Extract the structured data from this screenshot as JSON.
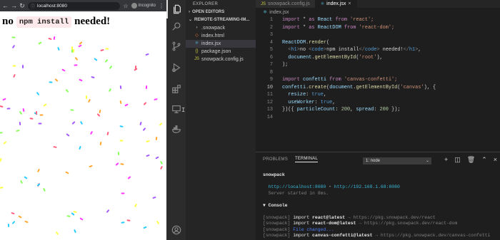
{
  "browser": {
    "url": "localhost:8080",
    "incognito_label": "Incognito",
    "heading_prefix": "no",
    "heading_code": "npm install",
    "heading_suffix": "needed!",
    "confetti_colors": [
      "#26ccff",
      "#a25afd",
      "#ff5e7e",
      "#88ff5a",
      "#fcff42",
      "#ffa62d",
      "#ff36ff"
    ]
  },
  "sidebar": {
    "title": "EXPLORER",
    "open_editors": "OPEN EDITORS",
    "project": "REMOTE-STREAMING-IM...",
    "files": [
      {
        "name": ".snowpack",
        "icon": "folder-icon",
        "icon_char": "›",
        "color": "#c5c5c5"
      },
      {
        "name": "index.html",
        "icon": "html-file-icon",
        "icon_char": "◇",
        "color": "#e37933"
      },
      {
        "name": "index.jsx",
        "icon": "jsx-file-icon",
        "icon_char": "⚛",
        "color": "#61dafb"
      },
      {
        "name": "package.json",
        "icon": "json-file-icon",
        "icon_char": "{}",
        "color": "#cbcb41"
      },
      {
        "name": "snowpack.config.js",
        "icon": "js-file-icon",
        "icon_char": "JS",
        "color": "#cbcb41"
      }
    ]
  },
  "editor": {
    "tabs": [
      {
        "label": "snowpack.config.js",
        "icon_char": "JS",
        "icon_color": "#cbcb41"
      },
      {
        "label": "index.jsx",
        "icon_char": "⚛",
        "icon_color": "#61dafb"
      }
    ],
    "breadcrumb": "index.jsx",
    "cursor_line": 10,
    "lines": [
      {
        "n": "1",
        "tokens": [
          [
            "import",
            "#c586c0"
          ],
          [
            " * ",
            "#d4d4d4"
          ],
          [
            "as",
            "#c586c0"
          ],
          [
            " React ",
            "#9cdcfe"
          ],
          [
            "from",
            "#c586c0"
          ],
          [
            " 'react';",
            "#ce9178"
          ]
        ]
      },
      {
        "n": "2",
        "tokens": [
          [
            "import",
            "#c586c0"
          ],
          [
            " * ",
            "#d4d4d4"
          ],
          [
            "as",
            "#c586c0"
          ],
          [
            " ReactDOM ",
            "#9cdcfe"
          ],
          [
            "from",
            "#c586c0"
          ],
          [
            " 'react-dom';",
            "#ce9178"
          ]
        ]
      },
      {
        "n": "3",
        "tokens": []
      },
      {
        "n": "4",
        "tokens": [
          [
            "ReactDOM",
            "#9cdcfe"
          ],
          [
            ".",
            "#d4d4d4"
          ],
          [
            "render",
            "#dcdcaa"
          ],
          [
            "(",
            "#d4d4d4"
          ]
        ]
      },
      {
        "n": "5",
        "tokens": [
          [
            "  <",
            "#808080"
          ],
          [
            "h1",
            "#569cd6"
          ],
          [
            ">",
            "#808080"
          ],
          [
            "no ",
            "#d4d4d4"
          ],
          [
            "<",
            "#808080"
          ],
          [
            "code",
            "#569cd6"
          ],
          [
            ">",
            "#808080"
          ],
          [
            "npm install",
            "#d4d4d4"
          ],
          [
            "</",
            "#808080"
          ],
          [
            "code",
            "#569cd6"
          ],
          [
            ">",
            "#808080"
          ],
          [
            " needed!",
            "#d4d4d4"
          ],
          [
            "</",
            "#808080"
          ],
          [
            "h1",
            "#569cd6"
          ],
          [
            ">",
            "#808080"
          ],
          [
            ",",
            "#d4d4d4"
          ]
        ]
      },
      {
        "n": "6",
        "tokens": [
          [
            "  document",
            "#9cdcfe"
          ],
          [
            ".",
            "#d4d4d4"
          ],
          [
            "getElementById",
            "#dcdcaa"
          ],
          [
            "(",
            "#d4d4d4"
          ],
          [
            "'root'",
            "#ce9178"
          ],
          [
            "),",
            "#d4d4d4"
          ]
        ]
      },
      {
        "n": "7",
        "tokens": [
          [
            ");",
            "#d4d4d4"
          ]
        ]
      },
      {
        "n": "8",
        "tokens": []
      },
      {
        "n": "9",
        "tokens": [
          [
            "import",
            "#c586c0"
          ],
          [
            " confetti ",
            "#9cdcfe"
          ],
          [
            "from",
            "#c586c0"
          ],
          [
            " 'canvas-confetti';",
            "#ce9178"
          ]
        ]
      },
      {
        "n": "10",
        "tokens": [
          [
            "confetti",
            "#9cdcfe"
          ],
          [
            ".",
            "#d4d4d4"
          ],
          [
            "create",
            "#dcdcaa"
          ],
          [
            "(",
            "#d4d4d4"
          ],
          [
            "document",
            "#9cdcfe"
          ],
          [
            ".",
            "#d4d4d4"
          ],
          [
            "getElementById",
            "#dcdcaa"
          ],
          [
            "(",
            "#d4d4d4"
          ],
          [
            "'canvas'",
            "#ce9178"
          ],
          [
            "), {",
            "#d4d4d4"
          ]
        ]
      },
      {
        "n": "11",
        "tokens": [
          [
            "  resize",
            "#9cdcfe"
          ],
          [
            ": ",
            "#d4d4d4"
          ],
          [
            "true",
            "#569cd6"
          ],
          [
            ",",
            "#d4d4d4"
          ]
        ]
      },
      {
        "n": "12",
        "tokens": [
          [
            "  useWorker",
            "#9cdcfe"
          ],
          [
            ": ",
            "#d4d4d4"
          ],
          [
            "true",
            "#569cd6"
          ],
          [
            ",",
            "#d4d4d4"
          ]
        ]
      },
      {
        "n": "13",
        "tokens": [
          [
            "})({ ",
            "#d4d4d4"
          ],
          [
            "particleCount",
            "#9cdcfe"
          ],
          [
            ": ",
            "#d4d4d4"
          ],
          [
            "200",
            "#b5cea8"
          ],
          [
            ", ",
            "#d4d4d4"
          ],
          [
            "spread",
            "#9cdcfe"
          ],
          [
            ": ",
            "#d4d4d4"
          ],
          [
            "200",
            "#b5cea8"
          ],
          [
            " });",
            "#d4d4d4"
          ]
        ]
      },
      {
        "n": "14",
        "tokens": []
      }
    ],
    "text_cursor": "I"
  },
  "panel": {
    "tabs": [
      {
        "label": "PROBLEMS",
        "active": false
      },
      {
        "label": "TERMINAL",
        "active": true
      }
    ],
    "terminal_select": "1: node",
    "icons": [
      "plus-icon",
      "split-terminal-icon",
      "trash-icon",
      "chevron-up-icon",
      "close-icon"
    ],
    "terminal_lines": [
      [
        [
          "snowpack",
          "t-bold"
        ]
      ],
      [],
      [
        [
          "  http://localhost:8080",
          "t-cyan"
        ],
        [
          " • ",
          "t-dim"
        ],
        [
          "http://192.168.1.68:8080",
          "t-cyan"
        ]
      ],
      [
        [
          "  Server started in 8ms.",
          "t-dim"
        ]
      ],
      [],
      [
        [
          "▼ ",
          "t-white"
        ],
        [
          "Console",
          "t-bold"
        ]
      ],
      [],
      [
        [
          "[snowpack] ",
          "t-dim"
        ],
        [
          "import ",
          "t-white"
        ],
        [
          "react@latest",
          "t-bold"
        ],
        [
          " → https://pkg.snowpack.dev/react",
          "t-dim"
        ]
      ],
      [
        [
          "[snowpack] ",
          "t-dim"
        ],
        [
          "import ",
          "t-white"
        ],
        [
          "react-dom@latest",
          "t-bold"
        ],
        [
          " → https://pkg.snowpack.dev/react-dom",
          "t-dim"
        ]
      ],
      [
        [
          "[snowpack] ",
          "t-dim"
        ],
        [
          "File changed...",
          "t-blue"
        ]
      ],
      [
        [
          "[snowpack] ",
          "t-dim"
        ],
        [
          "import ",
          "t-white"
        ],
        [
          "canvas-confetti@latest",
          "t-bold"
        ],
        [
          " → https://pkg.snowpack.dev/canvas-confetti",
          "t-dim"
        ]
      ]
    ]
  }
}
